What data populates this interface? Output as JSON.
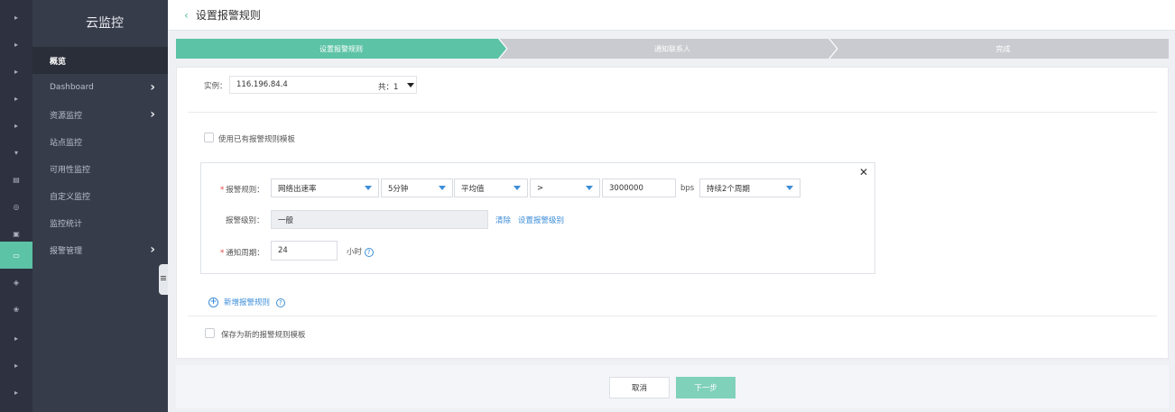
{
  "rail": {
    "items": [
      {
        "icon": "caret-right-icon",
        "glyph": "▸",
        "active": false
      },
      {
        "icon": "caret-right-icon",
        "glyph": "▸",
        "active": false
      },
      {
        "icon": "caret-right-icon",
        "glyph": "▸",
        "active": false
      },
      {
        "icon": "caret-right-icon",
        "glyph": "▸",
        "active": false
      },
      {
        "icon": "caret-right-icon",
        "glyph": "▸",
        "active": false
      },
      {
        "icon": "caret-down-icon",
        "glyph": "▾",
        "active": false
      },
      {
        "icon": "document-icon",
        "glyph": "▤",
        "active": false
      },
      {
        "icon": "settings-circle-icon",
        "glyph": "◎",
        "active": false
      },
      {
        "icon": "image-icon",
        "glyph": "▣",
        "active": false
      },
      {
        "icon": "monitor-icon",
        "glyph": "▭",
        "active": true
      },
      {
        "icon": "tag-icon",
        "glyph": "◈",
        "active": false
      },
      {
        "icon": "cluster-icon",
        "glyph": "❀",
        "active": false
      },
      {
        "icon": "caret-right-icon",
        "glyph": "▸",
        "active": false
      },
      {
        "icon": "caret-right-icon",
        "glyph": "▸",
        "active": false
      },
      {
        "icon": "caret-right-icon",
        "glyph": "▸",
        "active": false
      }
    ]
  },
  "sidebar": {
    "title": "云监控",
    "items": [
      {
        "label": "概览",
        "active": true,
        "chevron": false
      },
      {
        "label": "Dashboard",
        "active": false,
        "chevron": true
      },
      {
        "label": "资源监控",
        "active": false,
        "chevron": true
      },
      {
        "label": "站点监控",
        "active": false,
        "chevron": false
      },
      {
        "label": "可用性监控",
        "active": false,
        "chevron": false
      },
      {
        "label": "自定义监控",
        "active": false,
        "chevron": false
      },
      {
        "label": "监控统计",
        "active": false,
        "chevron": false
      },
      {
        "label": "报警管理",
        "active": false,
        "chevron": true
      }
    ],
    "chevron_glyph": "›"
  },
  "header": {
    "back_glyph": "‹",
    "title": "设置报警规则"
  },
  "steps": [
    {
      "label": "设置报警规则",
      "state": "active"
    },
    {
      "label": "通知联系人",
      "state": "pending"
    },
    {
      "label": "完成",
      "state": "pending"
    }
  ],
  "colors": {
    "accent": "#5cc3a6",
    "link": "#3d8ed8",
    "required": "#e0413c",
    "step_pending": "#c9cbd0"
  },
  "form": {
    "instance_label": "实例：",
    "instance_value": "116.196.84.4",
    "instance_count": "共：1",
    "use_template_label": "使用已有报警规则模板",
    "close_glyph": "✕",
    "rule": {
      "label": "报警规则：",
      "metric": "网络出速率",
      "period": "5分钟",
      "aggregate": "平均值",
      "operator": ">",
      "threshold": "3000000",
      "unit": "bps",
      "duration": "持续2个周期"
    },
    "level": {
      "label": "报警级别：",
      "value": "一般",
      "clear_link": "清除",
      "set_link": "设置报警级别"
    },
    "notify": {
      "label": "通知周期：",
      "value": "24",
      "unit": "小时",
      "help_glyph": "?"
    },
    "add_rule_label": "新增报警规则",
    "add_glyph": "+",
    "save_template_label": "保存为新的报警规则模板"
  },
  "footer": {
    "cancel_label": "取消",
    "next_label": "下一步"
  }
}
